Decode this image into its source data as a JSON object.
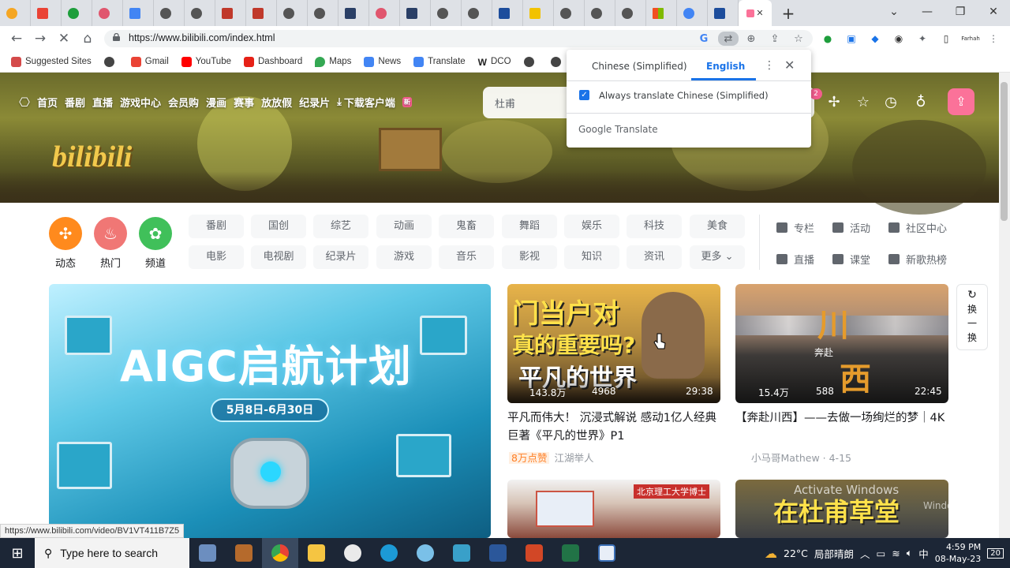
{
  "browser": {
    "tab_chars": [
      "",
      "",
      "",
      "",
      "",
      "",
      "",
      "",
      "",
      "",
      "",
      "",
      "",
      "",
      "",
      "",
      "",
      "",
      "",
      "",
      "",
      "",
      "",
      ""
    ],
    "address": "https://www.bilibili.com/index.html",
    "new_tab": "+",
    "tab_close": "✕",
    "extension_label": "Farhah"
  },
  "bookmarks": [
    {
      "label": "Suggested Sites",
      "color": "#d44a4a"
    },
    {
      "label": "",
      "color": "#444"
    },
    {
      "label": "Gmail",
      "color": "#ea4335"
    },
    {
      "label": "YouTube",
      "color": "#ff0000"
    },
    {
      "label": "Dashboard",
      "color": "#e62117"
    },
    {
      "label": "Maps",
      "color": "#34a853"
    },
    {
      "label": "News",
      "color": "#4285f4"
    },
    {
      "label": "Translate",
      "color": "#4285f4"
    },
    {
      "label": "DCO",
      "color": "#222"
    },
    {
      "label": "",
      "color": "#444"
    },
    {
      "label": "",
      "color": "#444"
    }
  ],
  "bili": {
    "nav": [
      "首页",
      "番剧",
      "直播",
      "游戏中心",
      "会员购",
      "漫画",
      "赛事",
      "放放假",
      "纪录片",
      "下载客户端"
    ],
    "new_tag": "新",
    "search_placeholder": "杜甫",
    "logo": "bilibili",
    "notif_count": "2",
    "circles": [
      {
        "label": "动态",
        "color": "#ff8a1d",
        "icon": "✣"
      },
      {
        "label": "热门",
        "color": "#f07775",
        "icon": "♨"
      },
      {
        "label": "频道",
        "color": "#40c05a",
        "icon": "✿"
      }
    ],
    "chips_row1": [
      "番剧",
      "国创",
      "综艺",
      "动画",
      "鬼畜",
      "舞蹈",
      "娱乐",
      "科技",
      "美食"
    ],
    "chips_row2": [
      "电影",
      "电视剧",
      "纪录片",
      "游戏",
      "音乐",
      "影视",
      "知识",
      "资讯",
      "更多 ⌄"
    ],
    "right_links": [
      "专栏",
      "活动",
      "社区中心",
      "直播",
      "课堂",
      "新歌热榜"
    ],
    "carousel": {
      "title": "AIGC启航计划",
      "date": "5月8日-6月30日"
    },
    "videos": [
      {
        "overlay1": "门当户对",
        "overlay2": "真的重要吗?",
        "overlay3": "平凡的世界",
        "plays": "143.8万",
        "danmaku": "4968",
        "duration": "29:38",
        "title": "平凡而伟大！ 沉浸式解说 感动1亿人经典巨著《平凡的世界》P1",
        "hot": "8万点赞",
        "author": "江湖举人"
      },
      {
        "overlay1": "川",
        "overlay2": "西",
        "overlay3": "奔赴",
        "plays": "15.4万",
        "danmaku": "588",
        "duration": "22:45",
        "title": "【奔赴川西】——去做一场绚烂的梦｜4K",
        "author": "小马哥Mathew · 4-15"
      },
      {
        "overlay1": "北京理工大学博士"
      },
      {
        "overlay1": "在杜甫草堂"
      }
    ],
    "refresh": [
      "换",
      "一",
      "换"
    ]
  },
  "translate_popup": {
    "source": "Chinese (Simplified)",
    "target": "English",
    "checkbox_label": "Always translate Chinese (Simplified)",
    "footer": "Google Translate"
  },
  "status_url": "https://www.bilibili.com/video/BV1VT411B7Z5",
  "watermark": [
    "Activate Windows",
    "Windows."
  ],
  "taskbar": {
    "search_placeholder": "Type here to search",
    "weather": "22°C",
    "weather_text": "局部晴朗",
    "time": "4:59 PM",
    "date": "08-May-23",
    "notifications": "20"
  }
}
